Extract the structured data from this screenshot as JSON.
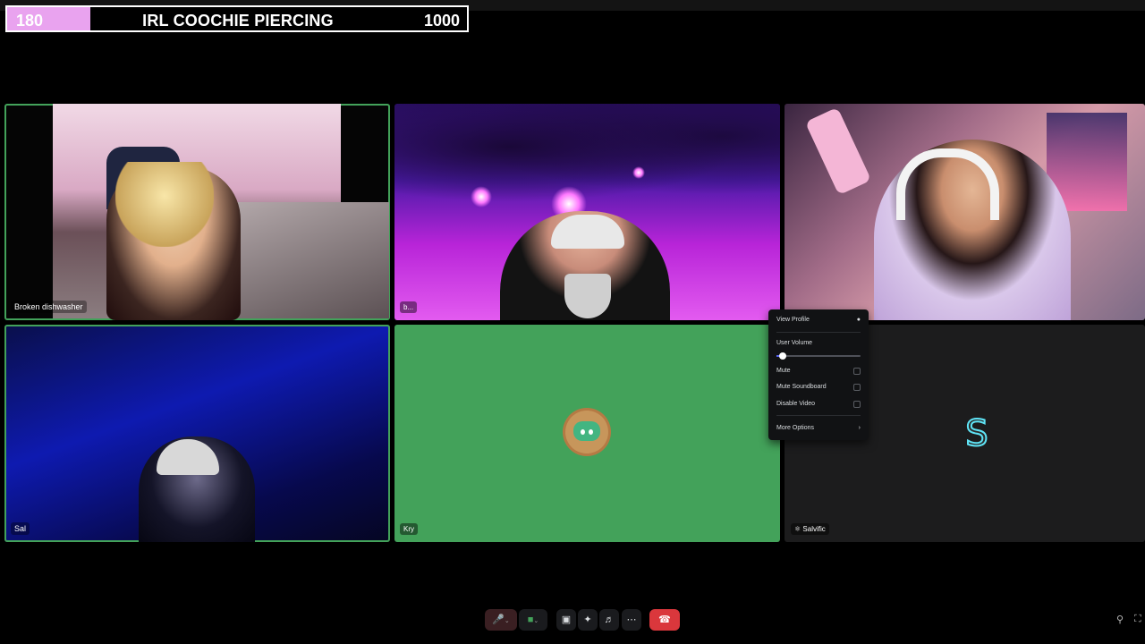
{
  "goal": {
    "current": "180",
    "title": "IRL COOCHIE PIERCING",
    "target": "1000",
    "progress": 0.18,
    "fill_color": "#e9a3ef"
  },
  "tiles": [
    {
      "name": "Broken dishwasher",
      "speaking": true
    },
    {
      "name": "b..."
    },
    {
      "name": ""
    },
    {
      "name": "Sal",
      "speaking": true
    },
    {
      "name": "Kry"
    },
    {
      "name": "Salvific",
      "icon": "activity-icon"
    }
  ],
  "menu": {
    "view_profile": "View Profile",
    "user_volume": "User Volume",
    "volume_level": 0.05,
    "mute": "Mute",
    "mute_soundboard": "Mute Soundboard",
    "disable_video": "Disable Video",
    "more_options": "More Options"
  },
  "controls": {
    "mic_icon": "microphone-muted-icon",
    "camera_icon": "camera-icon",
    "screen_share_icon": "screen-share-icon",
    "activities_icon": "activities-icon",
    "soundboard_icon": "soundboard-icon",
    "more_icon": "more-icon",
    "disconnect_icon": "phone-hangup-icon",
    "accent_end": "#da373c",
    "accent_speaking": "#43a25a"
  }
}
